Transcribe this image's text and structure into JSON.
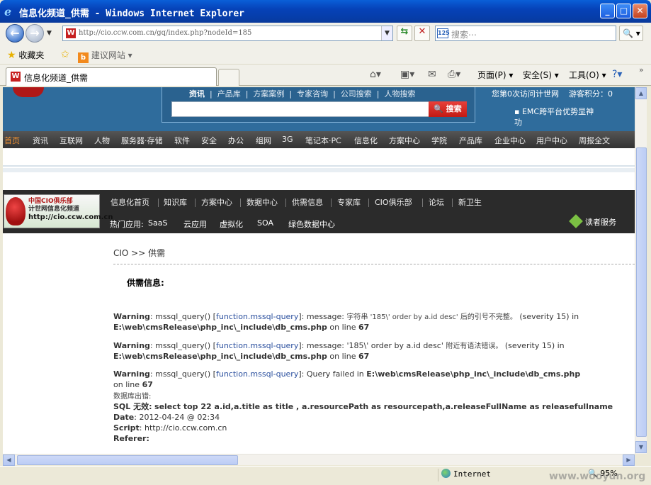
{
  "window": {
    "title": "信息化频道_供需 - Windows Internet Explorer",
    "buttons": {
      "minimize": "_",
      "maximize": "□",
      "close": "✕"
    }
  },
  "nav": {
    "address": "http://cio.ccw.com.cn/gq/index.php?nodeId=185",
    "search_placeholder": "搜索⋯",
    "search_logo": "125"
  },
  "favorites": {
    "favorites_label": "收藏夹",
    "suggested_sites": "建议网站"
  },
  "tab": {
    "label": "信息化频道_供需"
  },
  "command_bar": {
    "page": "页面(P)",
    "safety": "安全(S)",
    "tools": "工具(O)"
  },
  "site": {
    "top_nav": [
      "资讯",
      "产品库",
      "方案案例",
      "专家咨询",
      "公司搜索",
      "人物搜索"
    ],
    "search_button": "搜索",
    "visits": "您第0次访问计世网",
    "guest_points": "游客积分：0",
    "emc": "EMC跨平台优势显神功",
    "main_nav": [
      "首页",
      "资讯",
      "互联网",
      "人物",
      "服务器·存储",
      "软件",
      "安全",
      "办公",
      "组网",
      "3G",
      "笔记本·PC",
      "信息化",
      "方案中心",
      "学院",
      "产品库",
      "企业中心",
      "用户中心",
      "周报全文"
    ],
    "cio_logo": {
      "line1": "中国CIO俱乐部",
      "line2": "计世网信息化频道",
      "url": "http://cio.ccw.com.cn"
    },
    "cio_nav": [
      "信息化首页",
      "知识库",
      "方案中心",
      "数据中心",
      "供需信息",
      "专家库",
      "CIO俱乐部",
      "论坛",
      "新卫生"
    ],
    "hot_label": "热门应用:",
    "hot_items": [
      "SaaS",
      "云应用",
      "虚拟化",
      "SOA",
      "绿色数据中心"
    ],
    "reader_service": "读者服务"
  },
  "content": {
    "breadcrumb": "CIO >> 供需",
    "section_title": "供需信息:",
    "errors": [
      {
        "label": "Warning",
        "fn": "mssql_query()",
        "link": "function.mssql-query",
        "message_prefix": ": message: ",
        "message_cn": "字符串 '185\\' order by a.id desc' 后的引号不完整。",
        "message_tail": " (severity 15) in",
        "path": "E:\\web\\cmsRelease\\php_inc\\_include\\db_cms.php",
        "online": "on line",
        "line": "67"
      },
      {
        "label": "Warning",
        "fn": "mssql_query()",
        "link": "function.mssql-query",
        "message_prefix": ": message: '185\\' order by a.id desc' ",
        "message_cn": "附近有语法错误。",
        "message_tail": " (severity 15) in",
        "path": "E:\\web\\cmsRelease\\php_inc\\_include\\db_cms.php",
        "online": "on line",
        "line": "67"
      },
      {
        "label": "Warning",
        "fn": "mssql_query()",
        "link": "function.mssql-query",
        "message_prefix": ": Query failed in ",
        "path": "E:\\web\\cmsRelease\\php_inc\\_include\\db_cms.php",
        "online": "on line",
        "line": "67"
      }
    ],
    "db_error": "数据库出错:",
    "sql_label": "SQL 无效:",
    "sql": "select top 22 a.id,a.title as title , a.resourcePath as resourcepath,a.releaseFullName as releasefullname",
    "date_label": "Date",
    "date": "2012-04-24 @ 02:34",
    "script_label": "Script",
    "script": "http://cio.ccw.com.cn",
    "referer_label": "Referer:"
  },
  "status": {
    "zone": "Internet",
    "zoom": "95%",
    "watermark": "www.wooyun.org"
  }
}
